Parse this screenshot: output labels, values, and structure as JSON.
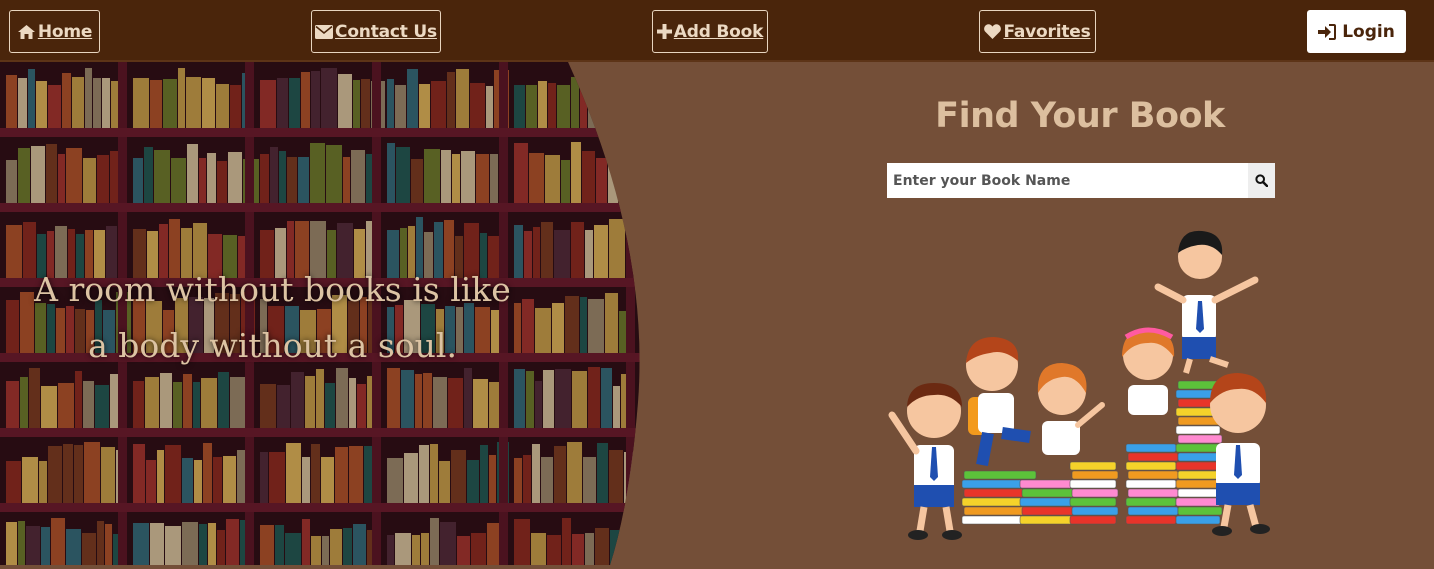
{
  "nav": {
    "home_label": "Home",
    "contact_label": "Contact Us",
    "add_book_label": "Add Book",
    "favorites_label": "Favorites",
    "login_label": "Login"
  },
  "hero": {
    "quote_line1": "A room without books is like",
    "quote_line2": "a body without a soul."
  },
  "search": {
    "title": "Find Your Book",
    "placeholder": "Enter your Book Name"
  },
  "colors": {
    "navbar": "#4a250b",
    "background": "#744f38",
    "title": "#dcbf9f"
  }
}
